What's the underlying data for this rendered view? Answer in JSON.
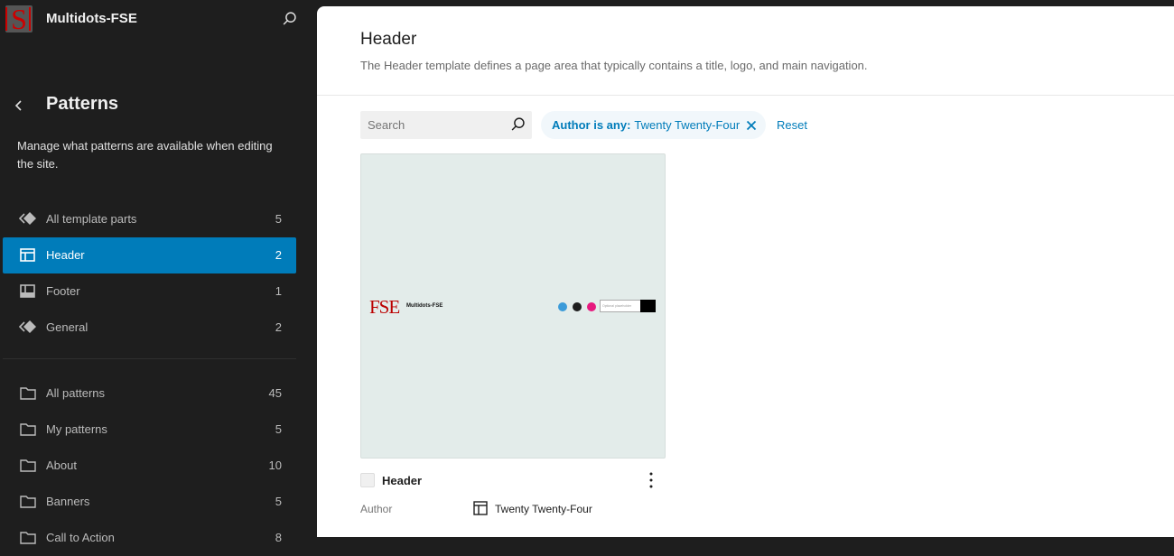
{
  "site": {
    "name": "Multidots-FSE",
    "logo_text": "S"
  },
  "sidebar": {
    "title": "Patterns",
    "description": "Manage what patterns are available when editing the site.",
    "template_parts": [
      {
        "label": "All template parts",
        "count": "5",
        "icon": "symbol-icon",
        "active": false
      },
      {
        "label": "Header",
        "count": "2",
        "icon": "header-layout-icon",
        "active": true
      },
      {
        "label": "Footer",
        "count": "1",
        "icon": "footer-layout-icon",
        "active": false
      },
      {
        "label": "General",
        "count": "2",
        "icon": "symbol-icon",
        "active": false
      }
    ],
    "pattern_categories": [
      {
        "label": "All patterns",
        "count": "45",
        "icon": "folder-icon"
      },
      {
        "label": "My patterns",
        "count": "5",
        "icon": "folder-icon"
      },
      {
        "label": "About",
        "count": "10",
        "icon": "folder-icon"
      },
      {
        "label": "Banners",
        "count": "5",
        "icon": "folder-icon"
      },
      {
        "label": "Call to Action",
        "count": "8",
        "icon": "folder-icon"
      }
    ]
  },
  "main": {
    "title": "Header",
    "description": "The Header template defines a page area that typically contains a title, logo, and main navigation.",
    "search": {
      "placeholder": "Search",
      "value": ""
    },
    "filter": {
      "key": "Author is any:",
      "value": "Twenty Twenty-Four"
    },
    "reset_label": "Reset",
    "cards": [
      {
        "title": "Header",
        "preview": {
          "logo": "FSE",
          "site_name": "Multidots-FSE",
          "search_placeholder": "Optional placeholder",
          "social_colors": [
            "#3b9bd9",
            "#1e1e1e",
            "#e6197e"
          ]
        },
        "meta_label": "Author",
        "meta_value": "Twenty Twenty-Four"
      }
    ]
  },
  "colors": {
    "accent": "#007cba",
    "sidebar_bg": "#1e1e1e",
    "preview_bg": "#e3ecea"
  }
}
